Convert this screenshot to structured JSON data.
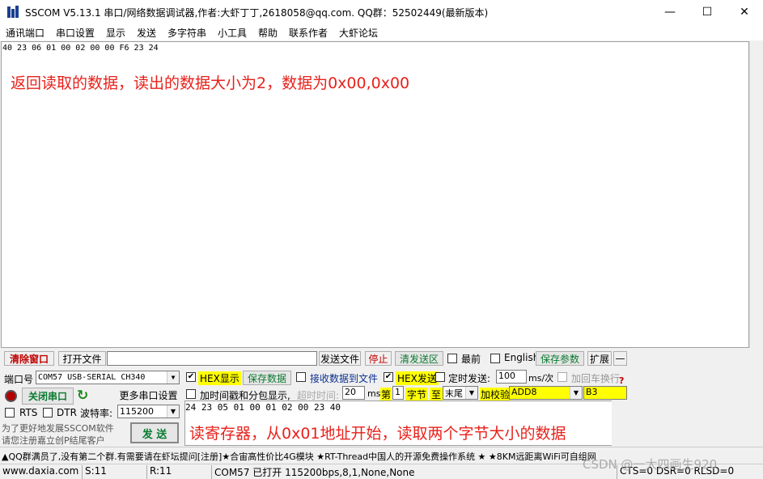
{
  "window": {
    "title": "SSCOM V5.13.1 串口/网络数据调试器,作者:大虾丁丁,2618058@qq.com. QQ群：52502449(最新版本)",
    "minimize_glyph": "—",
    "maximize_glyph": "☐",
    "close_glyph": "✕"
  },
  "menu": [
    "通讯端口",
    "串口设置",
    "显示",
    "发送",
    "多字符串",
    "小工具",
    "帮助",
    "联系作者",
    "大虾论坛"
  ],
  "receive": {
    "hex_data": "40 23 06 01 00 02 00 00 F6 23 24",
    "annotation": "返回读取的数据，读出的数据大小为2，数据为0x00,0x00"
  },
  "toolbar1": {
    "clear_window": "清除窗口",
    "open_file": "打开文件",
    "file_path": "",
    "send_file": "发送文件",
    "stop": "停止",
    "clear_send": "清发送区",
    "topmost_label": "最前",
    "english_label": "English",
    "save_params": "保存参数",
    "expand": "扩展",
    "collapse": "—"
  },
  "port": {
    "port_label": "端口号",
    "port_value": "COM57 USB-SERIAL CH340",
    "close_port": "关闭串口",
    "more_settings": "更多串口设置",
    "rts_label": "RTS",
    "dtr_label": "DTR",
    "baud_label": "波特率:",
    "baud_value": "115200",
    "promo_line1": "为了更好地发展SSCOM软件",
    "promo_line2": "请您注册嘉立创P结尾客户",
    "send_button": "发 送"
  },
  "options": {
    "hex_display": "HEX显示",
    "save_data": "保存数据",
    "recv_to_file": "接收数据到文件",
    "hex_send": "HEX发送",
    "timed_send": "定时发送:",
    "timed_value": "100",
    "timed_unit": "ms/次",
    "add_crlf": "加回车换行",
    "timestamp_label": "加时间戳和分包显示,",
    "timeout_label": "超时时间:",
    "timeout_value": "20",
    "timeout_unit": "ms",
    "byte_prefix": "第",
    "byte_index": "1",
    "byte_label": "字节",
    "to_label": "至",
    "end_value": "末尾",
    "checksum_label": "加校验",
    "checksum_value": "ADD8",
    "checksum_result": "B3"
  },
  "send": {
    "hex_data": "24 23 05 01 00 01 02 00 23 40",
    "annotation": "读寄存器，从0x01地址开始，读取两个字节大小的数据"
  },
  "news": "▲QQ群满员了,没有第二个群.有需要请在虾坛提问[注册]★合宙高性价比4G模块 ★RT-Thread中国人的开源免费操作系统 ★ ★8KM远距离WiFi可自组网",
  "status": {
    "website": "www.daxia.com",
    "sent": "S:11",
    "received": "R:11",
    "port_status": "COM57 已打开  115200bps,8,1,None,None",
    "signals": "CTS=0 DSR=0 RLSD=0"
  },
  "watermark": "CSDN @一大四画生920",
  "colors": {
    "annotation": "#e8211b",
    "highlight": "#ffff00",
    "button_green": "#0a7a2f",
    "clear_red": "#c00000"
  }
}
